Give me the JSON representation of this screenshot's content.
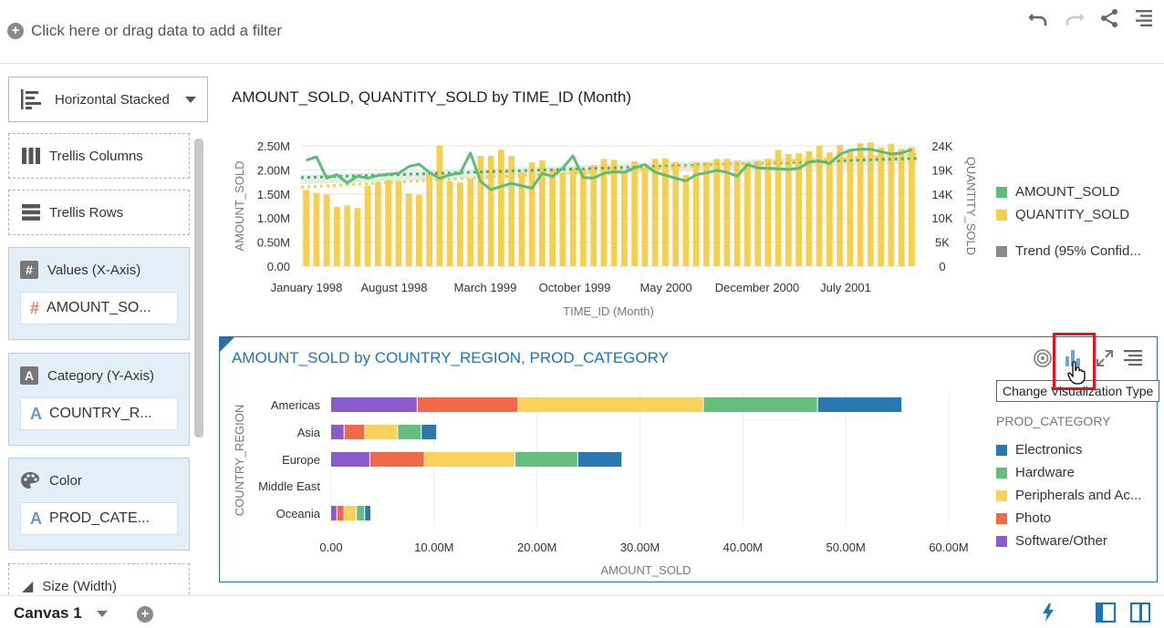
{
  "filter_bar": {
    "label": "Click here or drag data to add a filter"
  },
  "toolbar": {
    "undo": "undo-icon",
    "redo": "redo-icon",
    "share": "share-icon",
    "menu": "menu-icon"
  },
  "left_panel": {
    "viz_type": "Horizontal Stacked",
    "trellis_columns": "Trellis Columns",
    "trellis_rows": "Trellis Rows",
    "values_section": {
      "label": "Values (X-Axis)",
      "item": "AMOUNT_SO..."
    },
    "category_section": {
      "label": "Category (Y-Axis)",
      "item": "COUNTRY_R..."
    },
    "color_section": {
      "label": "Color",
      "item": "PROD_CATE..."
    },
    "size_section": {
      "label": "Size (Width)"
    }
  },
  "chart1": {
    "title": "AMOUNT_SOLD, QUANTITY_SOLD by TIME_ID (Month)",
    "legend": [
      "AMOUNT_SOLD",
      "QUANTITY_SOLD",
      "Trend (95% Confid..."
    ]
  },
  "chart2": {
    "title": "AMOUNT_SOLD by COUNTRY_REGION, PROD_CATEGORY",
    "legend_title": "PROD_CATEGORY",
    "legend": [
      "Electronics",
      "Hardware",
      "Peripherals and Ac...",
      "Photo",
      "Software/Other"
    ],
    "tooltip": "Change Visualization Type"
  },
  "bottom": {
    "canvas_tab": "Canvas 1"
  },
  "colors": {
    "amount": "#5cbd78",
    "quantity": "#f7cf4e",
    "trend": "#8a8a8a",
    "electronics": "#2a78b2",
    "hardware": "#66be7e",
    "peripherals": "#f9d25b",
    "photo": "#ef6b48",
    "software": "#8a5ccb",
    "accent": "#1a74b8"
  },
  "chart_data": [
    {
      "type": "bar",
      "title": "AMOUNT_SOLD, QUANTITY_SOLD by TIME_ID (Month)",
      "xlabel": "TIME_ID (Month)",
      "ylabel": "AMOUNT_SOLD",
      "y2label": "QUANTITY_SOLD",
      "ylim": [
        0,
        2500000
      ],
      "y2lim": [
        0,
        24000
      ],
      "yticks": [
        "0.00",
        "0.50M",
        "1.00M",
        "1.50M",
        "2.00M",
        "2.50M"
      ],
      "y2ticks": [
        "0",
        "5K",
        "10K",
        "14K",
        "19K",
        "24K"
      ],
      "xticks": [
        "January 1998",
        "August 1998",
        "March 1999",
        "October 1999",
        "May 2000",
        "December 2000",
        "July 2001"
      ],
      "series": [
        {
          "name": "QUANTITY_SOLD",
          "kind": "bar",
          "values": [
            15200,
            14600,
            14300,
            11800,
            12100,
            11600,
            16000,
            16800,
            17200,
            17000,
            14500,
            14200,
            18800,
            24100,
            17000,
            16700,
            17400,
            22000,
            22000,
            23200,
            22000,
            18800,
            20700,
            21100,
            19400,
            18700,
            19700,
            19300,
            20200,
            21400,
            21200,
            19000,
            20900,
            19700,
            21400,
            21500,
            20800,
            18200,
            20700,
            20700,
            21400,
            21400,
            21000,
            20600,
            21000,
            21400,
            23200,
            22400,
            22500,
            22900,
            24000,
            22700,
            24200,
            23400,
            24500,
            24700,
            23700,
            24400,
            23400,
            23700
          ]
        },
        {
          "name": "AMOUNT_SOLD",
          "kind": "line",
          "values": [
            2200000,
            2270000,
            1830000,
            1900000,
            1730000,
            1870000,
            1830000,
            1880000,
            1910000,
            1930000,
            2070000,
            2120000,
            1950000,
            1820000,
            1900000,
            1930000,
            2350000,
            1760000,
            1590000,
            1660000,
            1720000,
            1670000,
            1620000,
            1930000,
            1860000,
            2040000,
            2290000,
            1840000,
            1830000,
            1930000,
            1960000,
            1950000,
            2040000,
            2110000,
            1950000,
            1890000,
            1830000,
            1770000,
            1900000,
            1940000,
            1990000,
            1950000,
            1870000,
            2110000,
            2040000,
            2030000,
            2020000,
            2010000,
            2030000,
            2160000,
            2190000,
            2130000,
            2320000,
            2410000,
            2430000,
            2430000,
            2380000,
            2330000,
            2350000,
            2420000
          ]
        }
      ]
    },
    {
      "type": "bar",
      "orientation": "horizontal-stacked",
      "title": "AMOUNT_SOLD by COUNTRY_REGION, PROD_CATEGORY",
      "xlabel": "AMOUNT_SOLD",
      "ylabel": "COUNTRY_REGION",
      "xlim": [
        0,
        60000000
      ],
      "xticks": [
        "0.00",
        "10.00M",
        "20.00M",
        "30.00M",
        "40.00M",
        "50.00M",
        "60.00M"
      ],
      "categories": [
        "Americas",
        "Asia",
        "Europe",
        "Middle East",
        "Oceania"
      ],
      "series": [
        {
          "name": "Software/Other",
          "values": [
            8400000,
            1300000,
            3800000,
            0,
            600000
          ]
        },
        {
          "name": "Photo",
          "values": [
            9800000,
            2000000,
            5300000,
            0,
            700000
          ]
        },
        {
          "name": "Peripherals and Ac...",
          "values": [
            18000000,
            3200000,
            8800000,
            0,
            1200000
          ]
        },
        {
          "name": "Hardware",
          "values": [
            11100000,
            2300000,
            6100000,
            0,
            800000
          ]
        },
        {
          "name": "Electronics",
          "values": [
            8200000,
            1500000,
            4300000,
            0,
            600000
          ]
        }
      ]
    }
  ]
}
